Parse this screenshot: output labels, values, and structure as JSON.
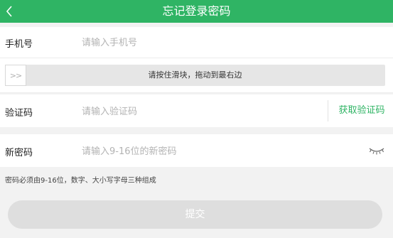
{
  "header": {
    "title": "忘记登录密码",
    "back_icon": "chevron-left-icon",
    "background_color": "#2fb464"
  },
  "phone_row": {
    "label": "手机号",
    "placeholder": "请输入手机号",
    "value": ""
  },
  "slider": {
    "text": "请按住滑块，拖动到最右边",
    "handle_glyph": ">>"
  },
  "code_row": {
    "label": "验证码",
    "placeholder": "请输入验证码",
    "value": "",
    "get_code_label": "获取验证码"
  },
  "newpwd_row": {
    "label": "新密码",
    "placeholder": "请输入9-16位的新密码",
    "value": "",
    "toggle_icon": "eye-closed-icon"
  },
  "hint": "密码必须由9-16位，数字、大小写字母三种组成",
  "submit_label": "提交",
  "colors": {
    "accent": "#2fb464",
    "submit_disabled": "#dedede"
  }
}
